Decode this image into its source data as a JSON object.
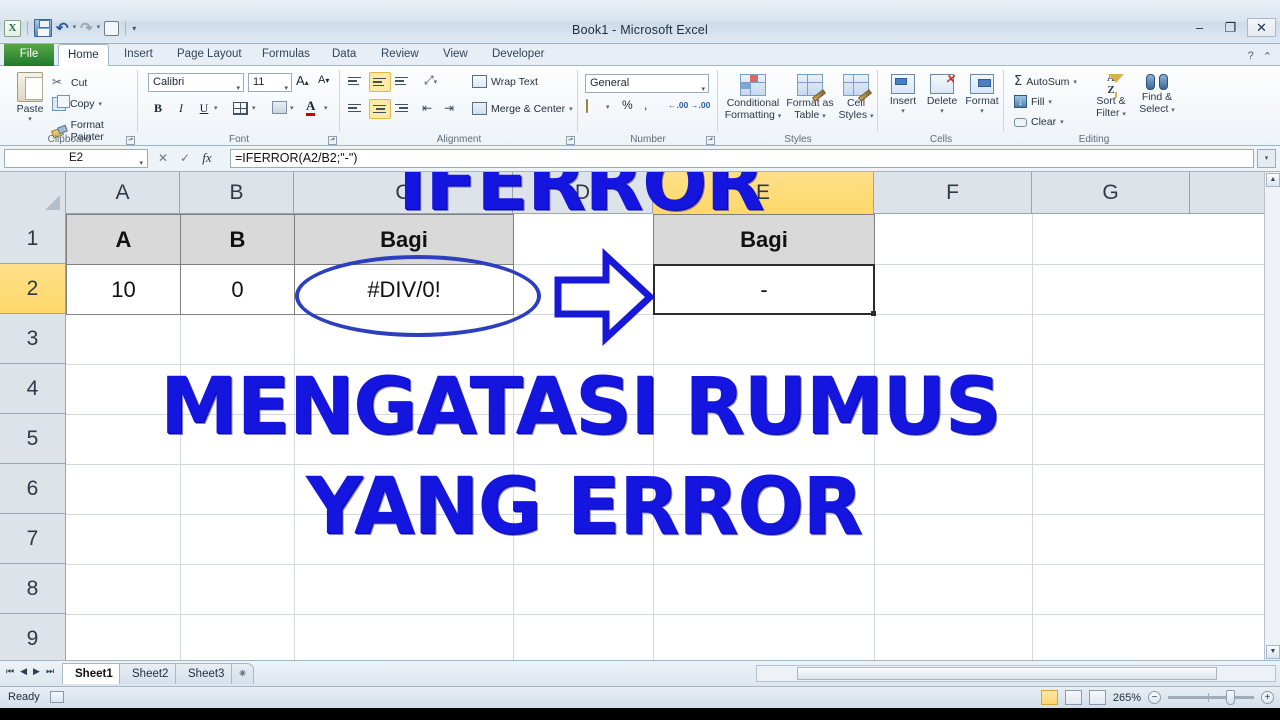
{
  "window": {
    "title": "Book1 - Microsoft Excel",
    "minimize": "–",
    "maximize": "❐",
    "close": "✕"
  },
  "quick_access": {
    "excel_badge": "X",
    "save": "save-icon",
    "undo": "↶",
    "redo": "↷",
    "print_preview": "print-preview-icon",
    "customize": "▾"
  },
  "ribbon": {
    "tabs": [
      {
        "label": "File",
        "active": false
      },
      {
        "label": "Home",
        "active": true
      },
      {
        "label": "Insert",
        "active": false
      },
      {
        "label": "Page Layout",
        "active": false
      },
      {
        "label": "Formulas",
        "active": false
      },
      {
        "label": "Data",
        "active": false
      },
      {
        "label": "Review",
        "active": false
      },
      {
        "label": "View",
        "active": false
      },
      {
        "label": "Developer",
        "active": false
      }
    ],
    "help": "?",
    "minimize_ribbon": "⌃",
    "groups": {
      "clipboard": {
        "label": "Clipboard",
        "paste": "Paste",
        "cut": "Cut",
        "copy": "Copy",
        "format_painter": "Format Painter"
      },
      "font": {
        "label": "Font",
        "font_name": "Calibri",
        "font_size": "11",
        "grow_font": "A",
        "shrink_font": "A",
        "bold": "B",
        "italic": "I",
        "underline": "U",
        "borders": "borders-icon",
        "fill_color": "fill-color-icon",
        "font_color": "A"
      },
      "alignment": {
        "label": "Alignment",
        "wrap_text": "Wrap Text",
        "merge_center": "Merge & Center",
        "orientation": "orientation-icon",
        "decrease_indent": "decrease-indent-icon",
        "increase_indent": "increase-indent-icon"
      },
      "number": {
        "label": "Number",
        "format": "General",
        "accounting": "accounting-format-icon",
        "percent": "%",
        "comma": ",",
        "increase_decimal": ".00",
        "decrease_decimal": ".00"
      },
      "styles": {
        "label": "Styles",
        "conditional_formatting": "Conditional Formatting",
        "format_as_table": "Format as Table",
        "cell_styles": "Cell Styles"
      },
      "cells": {
        "label": "Cells",
        "insert": "Insert",
        "delete": "Delete",
        "format": "Format"
      },
      "editing": {
        "label": "Editing",
        "autosum": "AutoSum",
        "fill": "Fill",
        "clear": "Clear",
        "sort_filter": "Sort & Filter",
        "find_select": "Find & Select"
      }
    }
  },
  "formula_bar": {
    "name_box": "E2",
    "cancel": "✕",
    "enter": "✓",
    "insert_function": "fx",
    "formula": "=IFERROR(A2/B2;\"-\")",
    "expand": "▾"
  },
  "grid": {
    "columns": [
      {
        "label": "A",
        "selected": false
      },
      {
        "label": "B",
        "selected": false
      },
      {
        "label": "C",
        "selected": false
      },
      {
        "label": "D",
        "selected": false
      },
      {
        "label": "E",
        "selected": true
      },
      {
        "label": "F",
        "selected": false
      },
      {
        "label": "G",
        "selected": false
      }
    ],
    "rows": [
      {
        "label": "1",
        "selected": false
      },
      {
        "label": "2",
        "selected": true
      },
      {
        "label": "3",
        "selected": false
      },
      {
        "label": "4",
        "selected": false
      },
      {
        "label": "5",
        "selected": false
      },
      {
        "label": "6",
        "selected": false
      },
      {
        "label": "7",
        "selected": false
      },
      {
        "label": "8",
        "selected": false
      },
      {
        "label": "9",
        "selected": false
      }
    ],
    "cells": {
      "a1": "A",
      "b1": "B",
      "c1": "Bagi",
      "e1": "Bagi",
      "a2": "10",
      "b2": "0",
      "c2": "#DIV/0!",
      "e2": "-"
    }
  },
  "overlay": {
    "title": "IFERROR",
    "line1": "MENGATASI RUMUS",
    "line2": "YANG ERROR",
    "color": "#1515e0",
    "annotation_color": "#2b3fbf"
  },
  "sheets": {
    "first": "⏮",
    "prev": "◀",
    "next": "▶",
    "last": "⏭",
    "tabs": [
      {
        "label": "Sheet1",
        "active": true
      },
      {
        "label": "Sheet2",
        "active": false
      },
      {
        "label": "Sheet3",
        "active": false
      }
    ],
    "insert_sheet": "insert-worksheet-icon"
  },
  "status": {
    "mode": "Ready",
    "macro_record": "record-macro-icon",
    "view_normal": "normal-view-icon",
    "view_page_layout": "page-layout-view-icon",
    "view_page_break": "page-break-view-icon",
    "zoom": "265%",
    "zoom_out": "−",
    "zoom_in": "+"
  }
}
